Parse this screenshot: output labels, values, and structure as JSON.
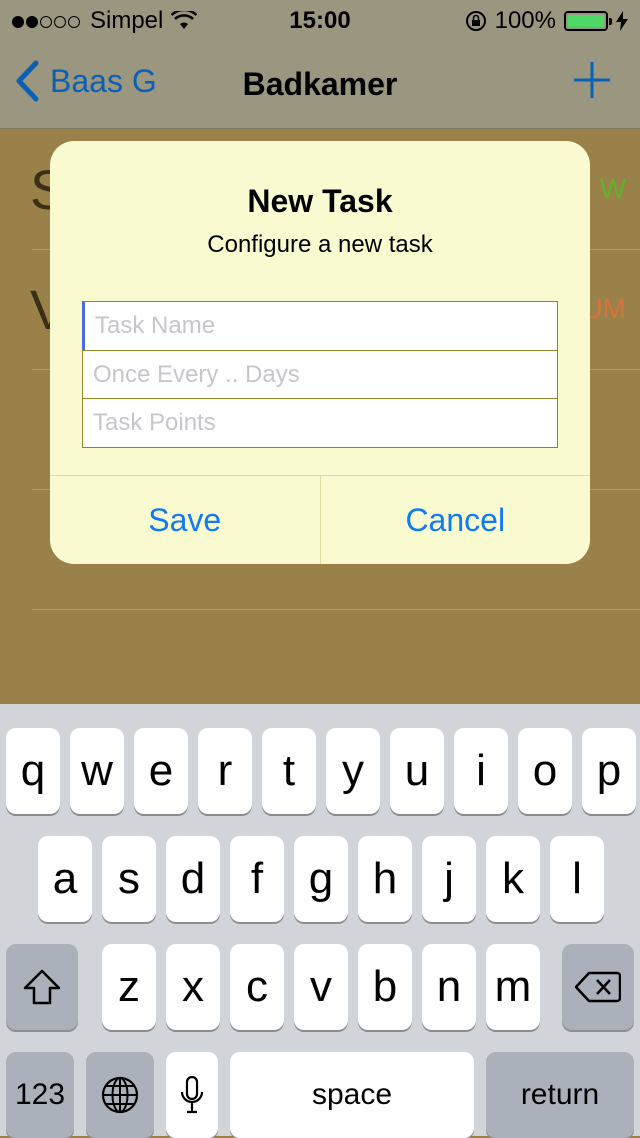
{
  "status": {
    "carrier": "Simpel",
    "time": "15:00",
    "battery": "100%",
    "signal_dots_filled": 2,
    "signal_dots_total": 5,
    "battery_level": 1.0
  },
  "nav": {
    "back_label": "Baas G",
    "title": "Badkamer",
    "add_icon": "plus-icon"
  },
  "list": {
    "rows": [
      {
        "letter": "S",
        "trail": "W",
        "trail_color": "#5fb42a"
      },
      {
        "letter": "V",
        "trail": "UM",
        "trail_color": "#d8743a"
      }
    ]
  },
  "dialog": {
    "title": "New Task",
    "message": "Configure a new task",
    "fields": [
      {
        "name": "task-name-field",
        "placeholder": "Task Name",
        "value": ""
      },
      {
        "name": "interval-field",
        "placeholder": "Once Every .. Days",
        "value": ""
      },
      {
        "name": "points-field",
        "placeholder": "Task Points",
        "value": ""
      }
    ],
    "save_label": "Save",
    "cancel_label": "Cancel"
  },
  "keyboard": {
    "row1": [
      "q",
      "w",
      "e",
      "r",
      "t",
      "y",
      "u",
      "i",
      "o",
      "p"
    ],
    "row2": [
      "a",
      "s",
      "d",
      "f",
      "g",
      "h",
      "j",
      "k",
      "l"
    ],
    "row3": [
      "z",
      "x",
      "c",
      "v",
      "b",
      "n",
      "m"
    ],
    "numbers_label": "123",
    "space_label": "space",
    "return_label": "return"
  },
  "colors": {
    "accent": "#0e7af6",
    "nav_tint": "#0a60b4",
    "dialog_bg": "#fafad0",
    "battery_fill": "#4cd964"
  }
}
